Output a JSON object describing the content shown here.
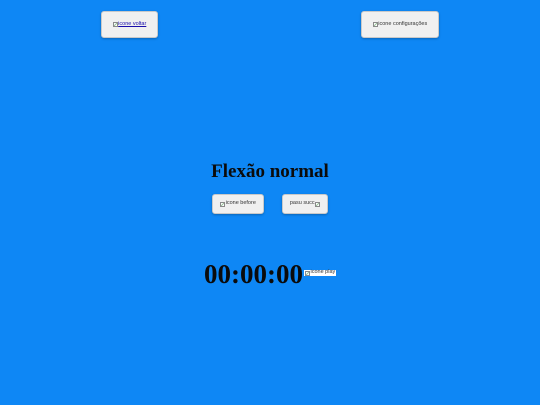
{
  "header": {
    "back_alt": "icone voltar",
    "settings_alt": "icone configurações"
  },
  "exercise": {
    "title": "Flexão normal",
    "before_alt": "icone before",
    "next_alt": "pasu succ"
  },
  "timer": {
    "value": "00:00:00",
    "play_alt": "icone play"
  },
  "colors": {
    "background": "#0e87f5",
    "button": "#f0f0f0",
    "text": "#0b0b0b"
  }
}
